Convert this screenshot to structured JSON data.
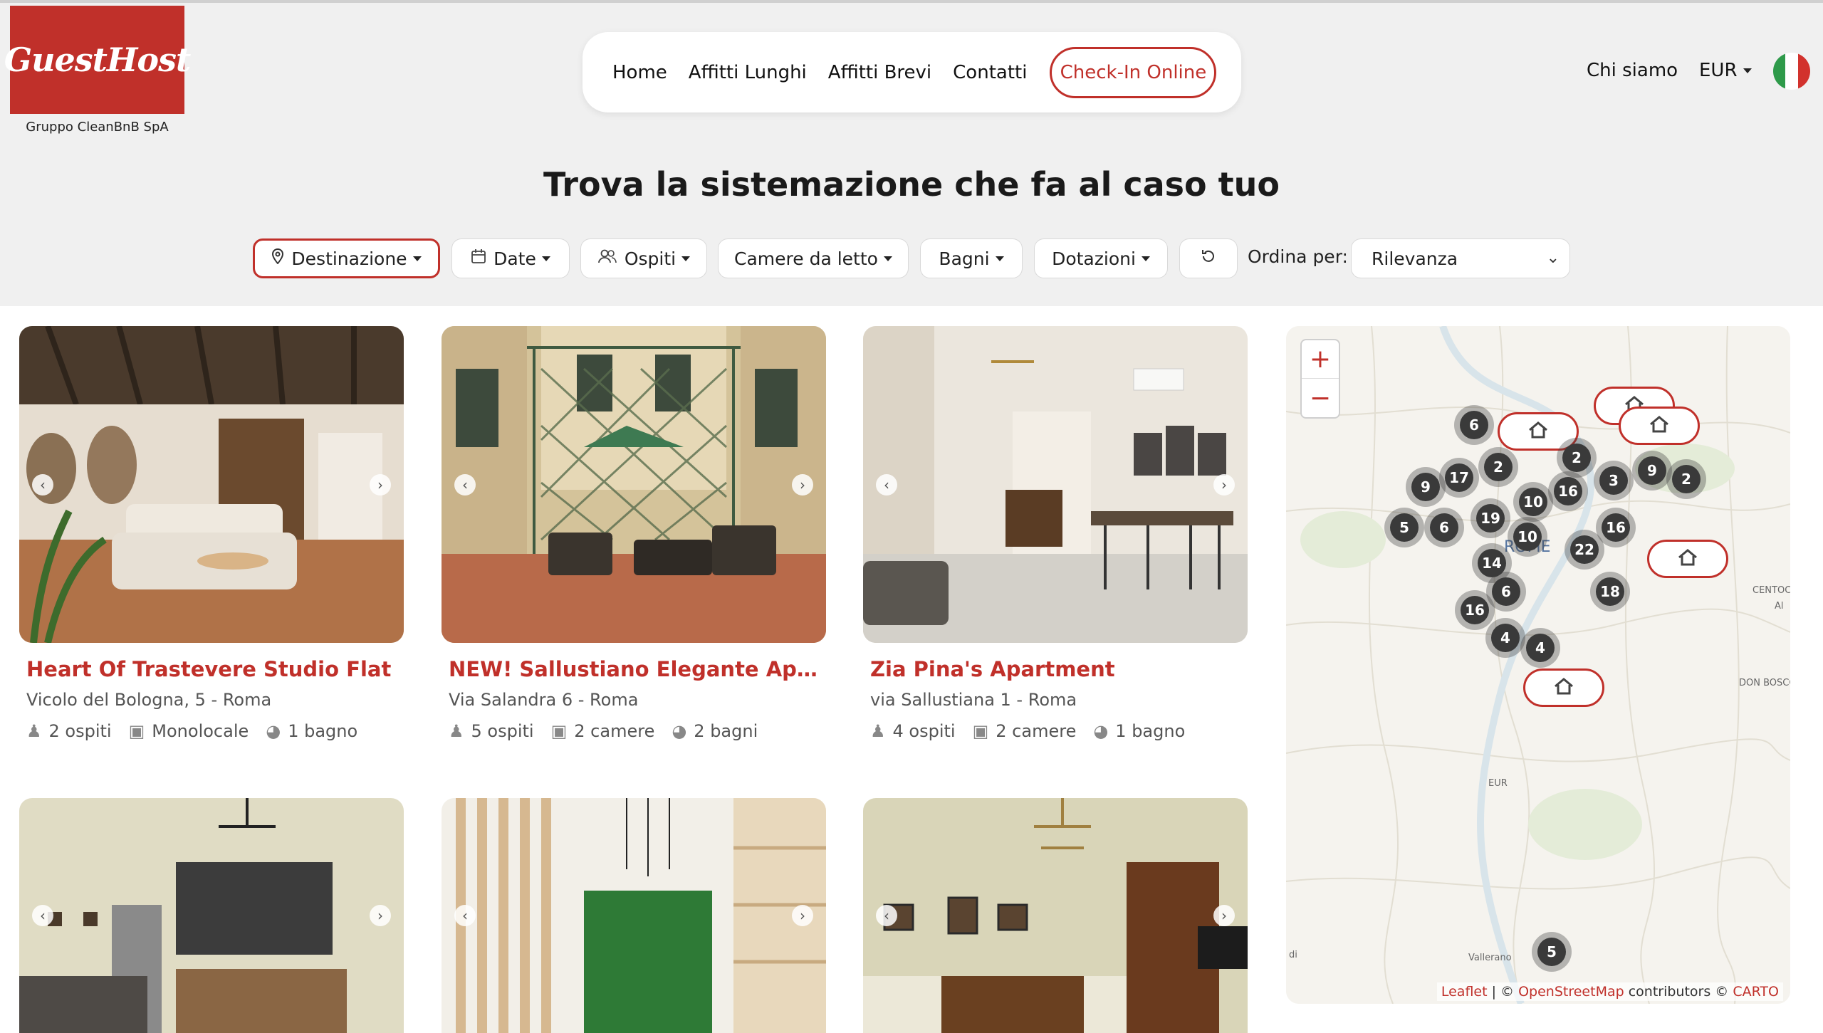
{
  "brand": {
    "name": "GuestHost",
    "tagline": "Gruppo CleanBnB SpA",
    "color": "#c0302a"
  },
  "nav": {
    "items": [
      "Home",
      "Affitti Lunghi",
      "Affitti Brevi",
      "Contatti"
    ],
    "checkin": "Check-In Online",
    "about": "Chi siamo",
    "currency": "EUR",
    "language_flag": "italy-flag-icon"
  },
  "headline": "Trova la sistemazione che fa al caso tuo",
  "filters": {
    "destination": "Destinazione",
    "dates": "Date",
    "guests": "Ospiti",
    "bedrooms": "Camere da letto",
    "bathrooms": "Bagni",
    "amenities": "Dotazioni",
    "reset_icon": "reset-icon",
    "sort_label": "Ordina per:",
    "sort_value": "Rilevanza"
  },
  "listings": [
    {
      "title": "Heart Of Trastevere Studio Flat",
      "address": "Vicolo del Bologna, 5 - Roma",
      "guests": "2 ospiti",
      "rooms": "Monolocale",
      "baths": "1 bagno"
    },
    {
      "title": "NEW! Sallustiano Elegante Appar...",
      "address": "Via Salandra 6 - Roma",
      "guests": "5 ospiti",
      "rooms": "2 camere",
      "baths": "2 bagni"
    },
    {
      "title": "Zia Pina's Apartment",
      "address": "via Sallustiana 1 - Roma",
      "guests": "4 ospiti",
      "rooms": "2 camere",
      "baths": "1 bagno"
    }
  ],
  "map": {
    "clusters": [
      "6",
      "2",
      "17",
      "9",
      "2",
      "3",
      "9",
      "2",
      "16",
      "10",
      "19",
      "5",
      "6",
      "10",
      "16",
      "22",
      "14",
      "6",
      "18",
      "16",
      "4",
      "4",
      "5"
    ],
    "labels": {
      "eur": "EUR",
      "vallerano": "Vallerano",
      "don_bosco": "DON BOSCO",
      "centocelle": "CENTOC",
      "al": "Al",
      "di": "di",
      "roma": "ROME"
    },
    "attribution": {
      "leaflet": "Leaflet",
      "sep": " | © ",
      "osm": "OpenStreetMap",
      "contrib": " contributors © ",
      "carto": "CARTO"
    }
  }
}
